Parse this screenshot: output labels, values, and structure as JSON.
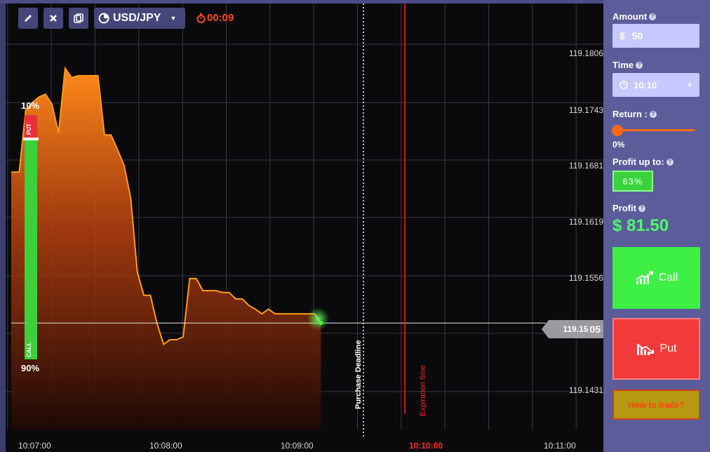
{
  "toolbar": {
    "pair": "USD/JPY",
    "timer": "00:09"
  },
  "chart": {
    "price_labels": [
      "119.1806",
      "119.1743",
      "119.1681",
      "119.1619",
      "119.1556",
      "119.1431"
    ],
    "time_labels": [
      "10:07:00",
      "10:08:00",
      "10:09:00",
      "10:10:00",
      "10:11:00"
    ],
    "current_price_main": "119.15",
    "current_price_tail": "05",
    "purchase_deadline": "Purchase Deadline",
    "expiration_time": "Expiration time",
    "sentiment": {
      "put_pct": "10%",
      "call_pct": "90%",
      "put_label": "PUT",
      "call_label": "CALL",
      "put_fraction": 0.1,
      "call_fraction": 0.9
    },
    "colors": {
      "line": "#ff9a1a",
      "expiration": "#ff2020",
      "current_point": "#3bff3b"
    }
  },
  "chart_data": {
    "type": "area",
    "xlabel": "",
    "ylabel": "",
    "x": [
      "10:07:00",
      "10:07:03",
      "10:07:06",
      "10:07:09",
      "10:07:12",
      "10:07:15",
      "10:07:18",
      "10:07:21",
      "10:07:24",
      "10:07:27",
      "10:07:30",
      "10:07:33",
      "10:07:36",
      "10:07:39",
      "10:07:42",
      "10:07:45",
      "10:07:48",
      "10:07:51",
      "10:07:54",
      "10:07:57",
      "10:08:00",
      "10:08:03",
      "10:08:06",
      "10:08:09",
      "10:08:12",
      "10:08:15",
      "10:08:18",
      "10:08:21",
      "10:08:24",
      "10:08:27",
      "10:08:30",
      "10:08:33",
      "10:08:36",
      "10:08:39",
      "10:08:42",
      "10:08:45",
      "10:08:48",
      "10:08:51",
      "10:08:54",
      "10:08:57",
      "10:09:00",
      "10:09:03",
      "10:09:06",
      "10:09:09",
      "10:09:12",
      "10:09:15",
      "10:09:18",
      "10:09:21"
    ],
    "values": [
      119.1668,
      119.1668,
      119.1735,
      119.1743,
      119.1749,
      119.1752,
      119.1741,
      119.171,
      119.178,
      119.177,
      119.1772,
      119.1772,
      119.1772,
      119.1772,
      119.1708,
      119.1708,
      119.1692,
      119.1675,
      119.164,
      119.156,
      119.1535,
      119.1535,
      119.1505,
      119.1482,
      119.1487,
      119.1487,
      119.149,
      119.1553,
      119.1553,
      119.154,
      119.154,
      119.154,
      119.1538,
      119.1538,
      119.1531,
      119.1531,
      119.1524,
      119.152,
      119.1515,
      119.152,
      119.1515,
      119.1515,
      119.1515,
      119.1515,
      119.1515,
      119.1515,
      119.1515,
      119.1505
    ],
    "ylim": [
      119.139,
      119.185
    ],
    "grid": true,
    "legend": "none"
  },
  "sidebar": {
    "amount_label": "Amount",
    "amount_value": "50",
    "amount_currency": "$",
    "time_label": "Time",
    "time_value": "10:10",
    "return_label": "Return :",
    "return_value": "0%",
    "profit_up_to_label": "Profit up to:",
    "profit_up_to_value": "63%",
    "profit_label": "Profit",
    "profit_value": "$ 81.50",
    "call_label": "Call",
    "put_label": "Put",
    "howto_label": "How to trade?"
  }
}
